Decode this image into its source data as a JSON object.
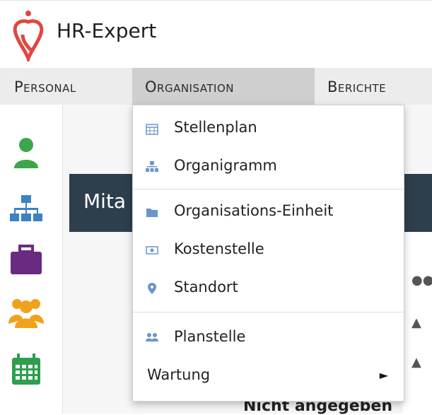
{
  "app": {
    "title": "HR-Expert"
  },
  "menubar": {
    "items": [
      {
        "label": "Personal"
      },
      {
        "label": "Organisation",
        "active": true
      },
      {
        "label": "Berichte"
      }
    ]
  },
  "dropdown": {
    "items": [
      {
        "label": "Stellenplan",
        "icon": "calendar-grid-icon"
      },
      {
        "label": "Organigramm",
        "icon": "org-chart-icon"
      },
      {
        "label": "Organisations-Einheit",
        "icon": "folder-icon"
      },
      {
        "label": "Kostenstelle",
        "icon": "money-icon"
      },
      {
        "label": "Standort",
        "icon": "map-pin-icon"
      },
      {
        "label": "Planstelle",
        "icon": "users-icon"
      },
      {
        "label": "Wartung",
        "icon": "",
        "submenu": true
      }
    ],
    "submenu_arrow": "►"
  },
  "sidebar": {
    "icons": [
      "person-icon",
      "org-chart-icon",
      "briefcase-icon",
      "group-icon",
      "calendar-icon"
    ]
  },
  "content": {
    "header_partial": "Mita",
    "bottom_text": "Nicht angegeben"
  },
  "colors": {
    "logo": "#e0473f",
    "sidebar_person": "#3aa84a",
    "sidebar_org": "#3b82c4",
    "sidebar_briefcase": "#6b2a82",
    "sidebar_group": "#f0a21d",
    "sidebar_calendar": "#2e9f4f",
    "dropdown_icon": "#6a96c8",
    "dark_header": "#2d3e4d"
  }
}
